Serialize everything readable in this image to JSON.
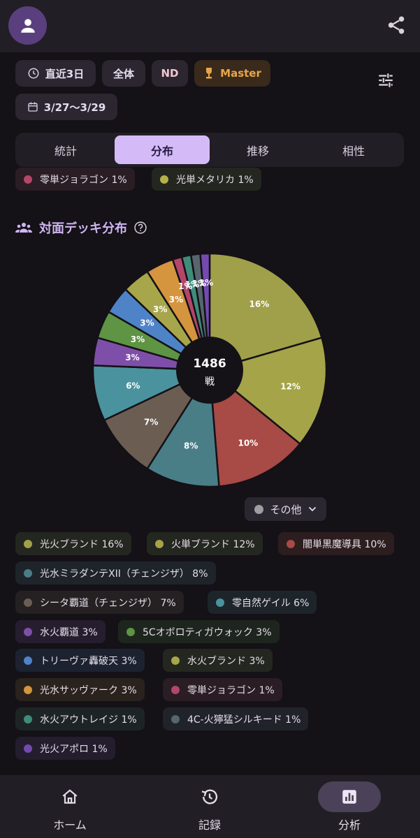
{
  "filters": {
    "period": "直近3日",
    "scope": "全体",
    "format": "ND",
    "rank": "Master",
    "date_range": "3/27〜3/29"
  },
  "tabs": [
    "統計",
    "分布",
    "推移",
    "相性"
  ],
  "active_tab": "分布",
  "top_legend": [
    {
      "label": "零単ジョラゴン 1%",
      "color": "#b4466a"
    },
    {
      "label": "光単メタリカ 1%",
      "color": "#b3b14a"
    }
  ],
  "section": {
    "title": "対面デッキ分布",
    "help_icon": "help-circle-icon",
    "people_icon": "groups-icon"
  },
  "chart_data": {
    "type": "pie",
    "total_label": "1486",
    "total_unit": "戦",
    "slices": [
      {
        "name": "光火ブランド",
        "value": 16,
        "label": "16%",
        "color": "#a0a04a"
      },
      {
        "name": "火単ブランド",
        "value": 12,
        "label": "12%",
        "color": "#a5a448"
      },
      {
        "name": "闇単黒魔導具",
        "value": 10,
        "label": "10%",
        "color": "#a84a45"
      },
      {
        "name": "光水ミラダンテXII（チェンジザ）",
        "value": 8,
        "label": "8%",
        "color": "#497e87"
      },
      {
        "name": "シータ覇道（チェンジザ）",
        "value": 7,
        "label": "7%",
        "color": "#6c5d52"
      },
      {
        "name": "零自然ゲイル",
        "value": 6,
        "label": "6%",
        "color": "#4a929e"
      },
      {
        "name": "水火覇道",
        "value": 3,
        "label": "3%",
        "color": "#7e4fa8"
      },
      {
        "name": "5Cオボロティガウォック",
        "value": 3,
        "label": "3%",
        "color": "#5e9444"
      },
      {
        "name": "トリーヴァ轟破天",
        "value": 3,
        "label": "3%",
        "color": "#4f83c8"
      },
      {
        "name": "水火ブランド",
        "value": 3,
        "label": "3%",
        "color": "#a7a64a"
      },
      {
        "name": "光水サッヴァーク",
        "value": 3,
        "label": "3%",
        "color": "#d4953e"
      },
      {
        "name": "零単ジョラゴン",
        "value": 1,
        "label": "1%",
        "color": "#b4466a"
      },
      {
        "name": "水火アウトレイジ",
        "value": 1,
        "label": "1%",
        "color": "#3f8c7b"
      },
      {
        "name": "4C-火獰猛シルキード",
        "value": 1,
        "label": "1%",
        "color": "#58656c"
      },
      {
        "name": "光火アポロ",
        "value": 1,
        "label": "1%",
        "color": "#7449b0"
      }
    ]
  },
  "other_button": "その他",
  "legend": [
    {
      "label": "光火ブランド 16%",
      "color": "#a0a04a",
      "bg": "#242720"
    },
    {
      "label": "火単ブランド 12%",
      "color": "#a5a448",
      "bg": "#242720"
    },
    {
      "label": "闇単黒魔導具 10%",
      "color": "#a84a45",
      "bg": "#2c1d1f"
    },
    {
      "label": "光水ミラダンテXII（チェンジザ） 8%",
      "color": "#497e87",
      "bg": "#1e2429"
    },
    {
      "label": "シータ覇道（チェンジザ） 7%",
      "color": "#6c5d52",
      "bg": "#252022"
    },
    {
      "label": "零自然ゲイル 6%",
      "color": "#4a929e",
      "bg": "#1d252a"
    },
    {
      "label": "水火覇道 3%",
      "color": "#7e4fa8",
      "bg": "#261e2e"
    },
    {
      "label": "5Cオボロティガウォック 3%",
      "color": "#5e9444",
      "bg": "#1e251e"
    },
    {
      "label": "トリーヴァ轟破天 3%",
      "color": "#4f83c8",
      "bg": "#1d2230"
    },
    {
      "label": "水火ブランド 3%",
      "color": "#a7a64a",
      "bg": "#242720"
    },
    {
      "label": "光水サッヴァーク 3%",
      "color": "#d4953e",
      "bg": "#2a221d"
    },
    {
      "label": "零単ジョラゴン 1%",
      "color": "#b4466a",
      "bg": "#2a1d23"
    },
    {
      "label": "水火アウトレイジ 1%",
      "color": "#3f8c7b",
      "bg": "#1d2524"
    },
    {
      "label": "4C-火獰猛シルキード 1%",
      "color": "#58656c",
      "bg": "#21232a"
    },
    {
      "label": "光火アポロ 1%",
      "color": "#7449b0",
      "bg": "#231d2e"
    }
  ],
  "nav": [
    {
      "label": "ホーム",
      "icon": "home-icon"
    },
    {
      "label": "記録",
      "icon": "history-icon"
    },
    {
      "label": "分析",
      "icon": "analytics-icon"
    }
  ],
  "active_nav": "分析"
}
